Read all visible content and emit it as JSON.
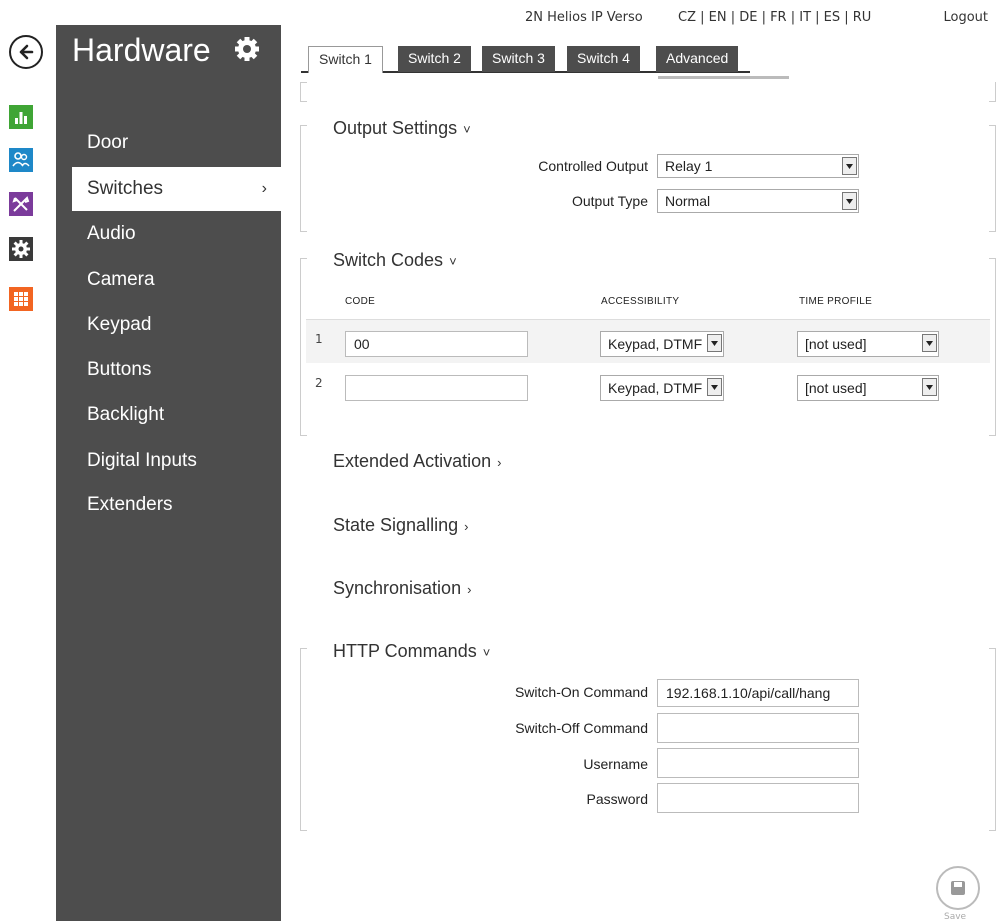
{
  "topbar": {
    "device_name": "2N Helios IP Verso",
    "languages": "CZ | EN | DE | FR | IT | ES | RU",
    "logout": "Logout"
  },
  "nav_icons": [
    {
      "name": "status-icon",
      "color": "#3fa535"
    },
    {
      "name": "directory-icon",
      "color": "#1e88c8"
    },
    {
      "name": "hardware-tools-icon",
      "color": "#7b3b9b"
    },
    {
      "name": "services-gear-icon",
      "color": "#3a3a3a"
    },
    {
      "name": "system-grid-icon",
      "color": "#f26522"
    }
  ],
  "sidebar": {
    "title": "Hardware",
    "items": [
      {
        "label": "Door"
      },
      {
        "label": "Switches",
        "active": true
      },
      {
        "label": "Audio"
      },
      {
        "label": "Camera"
      },
      {
        "label": "Keypad"
      },
      {
        "label": "Buttons"
      },
      {
        "label": "Backlight"
      },
      {
        "label": "Digital Inputs"
      },
      {
        "label": "Extenders"
      }
    ],
    "active_chevron": "›"
  },
  "tabs": [
    {
      "label": "Switch 1",
      "active": true
    },
    {
      "label": "Switch 2"
    },
    {
      "label": "Switch 3"
    },
    {
      "label": "Switch 4"
    },
    {
      "label": "Advanced"
    }
  ],
  "output_settings": {
    "title": "Output Settings",
    "caret": "˅",
    "controlled_output_label": "Controlled Output",
    "controlled_output_value": "Relay 1",
    "output_type_label": "Output Type",
    "output_type_value": "Normal"
  },
  "switch_codes": {
    "title": "Switch Codes",
    "caret": "˅",
    "columns": [
      "CODE",
      "ACCESSIBILITY",
      "TIME PROFILE"
    ],
    "rows": [
      {
        "num": "1",
        "code": "00",
        "accessibility": "Keypad, DTMF",
        "time_profile": "[not used]"
      },
      {
        "num": "2",
        "code": "",
        "accessibility": "Keypad, DTMF",
        "time_profile": "[not used]"
      }
    ]
  },
  "collapsed_sections": [
    {
      "title": "Extended Activation",
      "caret": "›"
    },
    {
      "title": "State Signalling",
      "caret": "›"
    },
    {
      "title": "Synchronisation",
      "caret": "›"
    }
  ],
  "http_commands": {
    "title": "HTTP Commands",
    "caret": "˅",
    "switch_on_label": "Switch-On Command",
    "switch_on_value": "192.168.1.10/api/call/hang",
    "switch_off_label": "Switch-Off Command",
    "switch_off_value": "",
    "username_label": "Username",
    "username_value": "",
    "password_label": "Password",
    "password_value": ""
  },
  "save": {
    "label": "Save"
  }
}
